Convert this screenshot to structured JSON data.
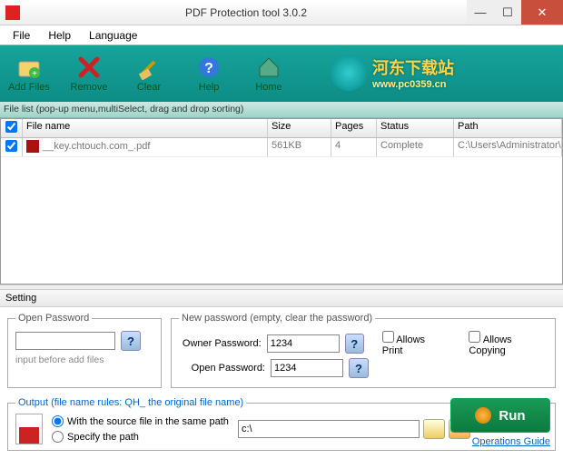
{
  "window": {
    "title": "PDF Protection tool 3.0.2"
  },
  "menu": {
    "file": "File",
    "help": "Help",
    "language": "Language"
  },
  "toolbar": {
    "add": "Add Files",
    "remove": "Remove",
    "clear": "Clear",
    "help": "Help",
    "home": "Home"
  },
  "watermark": {
    "text": "河东下载站",
    "url": "www.pc0359.cn"
  },
  "filelist": {
    "header": "File list (pop-up menu,multiSelect, drag and drop sorting)",
    "cols": {
      "name": "File name",
      "size": "Size",
      "pages": "Pages",
      "status": "Status",
      "path": "Path"
    },
    "rows": [
      {
        "name": "__key.chtouch.com_.pdf",
        "size": "561KB",
        "pages": "4",
        "status": "Complete",
        "path": "C:\\Users\\Administrator\\Desk..."
      }
    ]
  },
  "setting": {
    "title": "Setting",
    "openpw": {
      "legend": "Open Password",
      "value": "",
      "hint": "input before add  files"
    },
    "newpw": {
      "legend": "New password (empty, clear the password)",
      "owner_label": "Owner Password:",
      "owner_value": "1234",
      "open_label": "Open Password:",
      "open_value": "1234",
      "allow_print": "Allows Print",
      "allow_copy": "Allows Copying"
    }
  },
  "output": {
    "legend": "Output (file name rules: QH_ the original file name)",
    "radio_same": "With the source file in the same path",
    "radio_specify": "Specify the path",
    "path_value": "c:\\"
  },
  "run": {
    "label": "Run",
    "guide": "Operations Guide"
  }
}
